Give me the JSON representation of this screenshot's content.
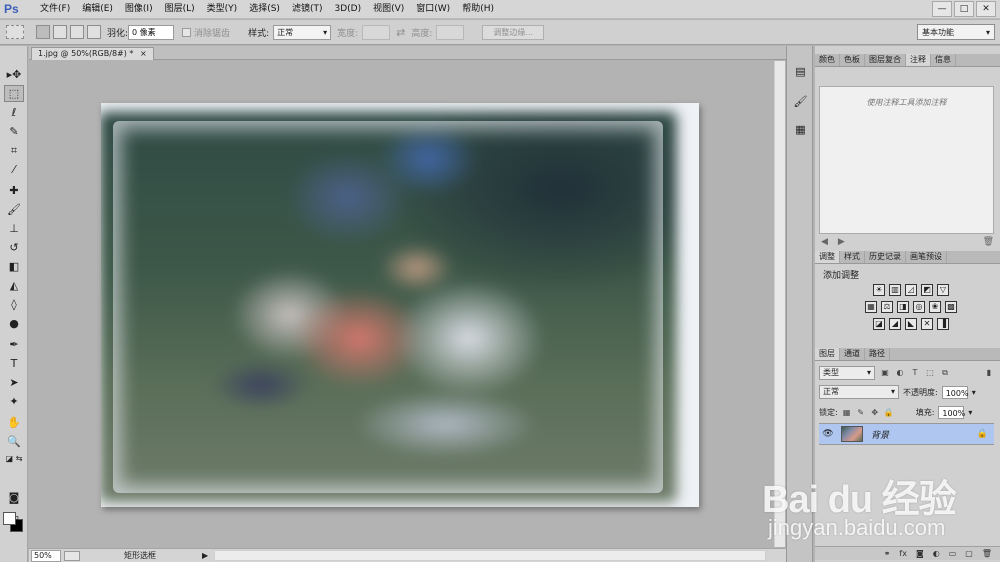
{
  "app": {
    "logo": "Ps",
    "menus": [
      "文件(F)",
      "编辑(E)",
      "图像(I)",
      "图层(L)",
      "类型(Y)",
      "选择(S)",
      "滤镜(T)",
      "3D(D)",
      "视图(V)",
      "窗口(W)",
      "帮助(H)"
    ],
    "window_controls": [
      "—",
      "□",
      "✕"
    ]
  },
  "options": {
    "feather_label": "羽化:",
    "feather_value": "0 像素",
    "antialias_label": "消除锯齿",
    "style_label": "样式:",
    "style_value": "正常",
    "width_label": "宽度:",
    "height_label": "高度:",
    "refine_edge": "调整边缘...",
    "workspace": "基本功能"
  },
  "document": {
    "tab_title": "1.jpg @ 50%(RGB/8#) *",
    "close": "×"
  },
  "status": {
    "zoom": "50%",
    "tool_name": "矩形选框",
    "arrow": "▶"
  },
  "panels": {
    "top_tabs": [
      "颜色",
      "色板",
      "图层复合",
      "注释",
      "信息"
    ],
    "notes_hint": "使用注释工具添加注释",
    "adjust_tabs": [
      "调整",
      "样式",
      "历史记录",
      "画笔预设"
    ],
    "adjust_title": "添加调整",
    "layer_tabs": [
      "图层",
      "通道",
      "路径"
    ],
    "layer_kind": "类型",
    "blend_mode": "正常",
    "opacity_label": "不透明度:",
    "opacity_value": "100%",
    "lock_label": "锁定:",
    "fill_label": "填充:",
    "fill_value": "100%",
    "layer_name": "背景"
  },
  "watermark": {
    "main": "Bai du 经验",
    "sub": "jingyan.baidu.com"
  },
  "colors": {
    "accent": "#3d5fb8",
    "selected_layer": "#aec6f0"
  }
}
